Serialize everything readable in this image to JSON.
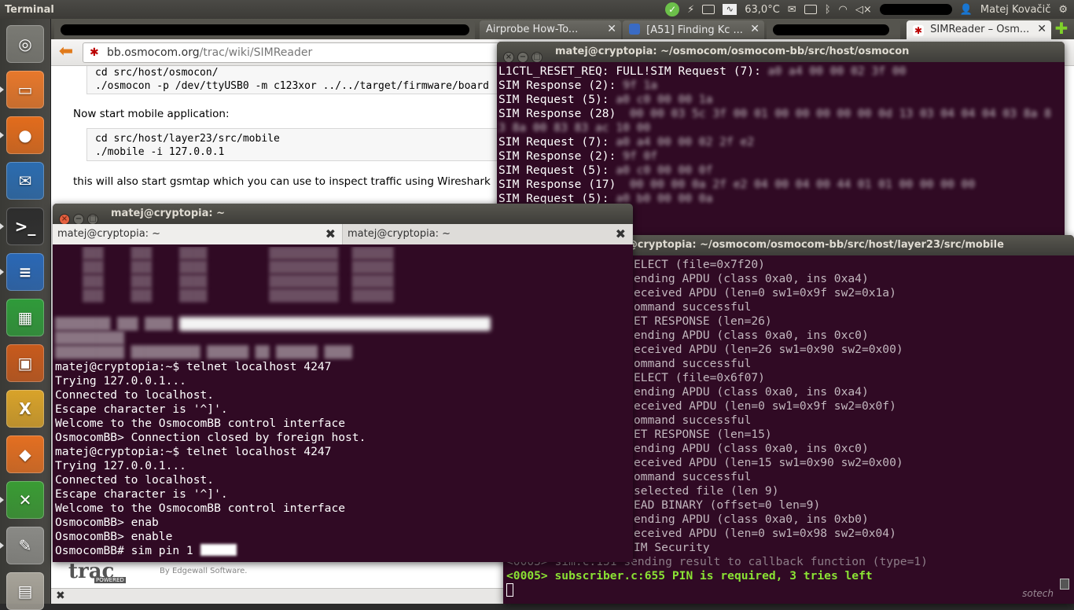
{
  "top_panel": {
    "app_title": "Terminal",
    "temperature": "63,0°C",
    "user_name": "Matej Kovačič"
  },
  "launcher": {
    "items": [
      {
        "name": "dash-home",
        "glyph": "◎",
        "color": "#7a7a74"
      },
      {
        "name": "files",
        "glyph": "▭",
        "color": "#e8782b"
      },
      {
        "name": "firefox",
        "glyph": "●",
        "color": "#e36c1c"
      },
      {
        "name": "thunderbird",
        "glyph": "✉",
        "color": "#2b6cb0"
      },
      {
        "name": "terminal",
        "glyph": ">_",
        "color": "#2d2d2d"
      },
      {
        "name": "writer",
        "glyph": "≡",
        "color": "#2a68b6"
      },
      {
        "name": "calc",
        "glyph": "▦",
        "color": "#2f9b3a"
      },
      {
        "name": "impress",
        "glyph": "▣",
        "color": "#c85a1c"
      },
      {
        "name": "xchat",
        "glyph": "X",
        "color": "#d9a32a"
      },
      {
        "name": "software-center",
        "glyph": "◆",
        "color": "#e46f21"
      },
      {
        "name": "x-app",
        "glyph": "✕",
        "color": "#3a9c34"
      },
      {
        "name": "text-editor",
        "glyph": "✎",
        "color": "#8a8a86"
      },
      {
        "name": "printer",
        "glyph": "▤",
        "color": "#a8a49a"
      }
    ]
  },
  "browser": {
    "tabs": [
      {
        "label": "Airprobe How-To..."
      },
      {
        "label": "[A51] Finding Kc ..."
      },
      {
        "label": "SIMReader – Osm..."
      }
    ],
    "url_domain": "bb.osmocom.org",
    "url_path": "/trac/wiki/SIMReader",
    "code1_lines": [
      "cd src/host/osmocon/",
      "./osmocon -p /dev/ttyUSB0 -m c123xor ../../target/firmware/board"
    ],
    "text1": "Now start mobile application:",
    "code2_lines": [
      "cd src/host/layer23/src/mobile",
      "./mobile -i 127.0.0.1"
    ],
    "text2": "this will also start gsmtap which you can use to inspect traffic using Wireshark",
    "trac_logo": "trac",
    "trac_powered": "POWERED",
    "edgewall": "By Edgewall Software."
  },
  "osmocon_terminal": {
    "title": "matej@cryptopia: ~/osmocom/osmocom-bb/src/host/osmocon",
    "lines": [
      "L1CTL_RESET_REQ: FULL!SIM Request (7): ",
      "SIM Response (2): ",
      "SIM Request (5): ",
      "SIM Response (28) ",
      "",
      "SIM Request (7): ",
      "SIM Response (2): ",
      "SIM Request (5): ",
      "SIM Response (17) ",
      "SIM Request (5): "
    ],
    "blurred_hex": [
      "a0 a4 00 00 02 3f 00",
      "9f 1a",
      "a0 c0 00 00 1a",
      " 00 00 03 5c 3f 00 01 00 00 00 00 00 0d 13 03 04 04 04 03 8a 8",
      "3 8a 00 83 83 ac 10 00",
      "a0 a4 00 00 02 2f e2",
      "9f 0f",
      "a0 c0 00 00 0f",
      " 00 00 00 0a 2f e2 04 00 04 00 44 01 01 00 00 00 00",
      "a0 b0 00 00 0a"
    ]
  },
  "mobile_terminal": {
    "title": "matej@cryptopia: ~/osmocom/osmocom-bb/src/host/layer23/src/mobile",
    "lines": [
      "ELECT (file=0x7f20)",
      "ending APDU (class 0xa0, ins 0xa4)",
      "eceived APDU (len=0 sw1=0x9f sw2=0x1a)",
      "ommand successful",
      "ET RESPONSE (len=26)",
      "ending APDU (class 0xa0, ins 0xc0)",
      "eceived APDU (len=26 sw1=0x90 sw2=0x00)",
      "ommand successful",
      "ELECT (file=0x6f07)",
      "ending APDU (class 0xa0, ins 0xa4)",
      "eceived APDU (len=0 sw1=0x9f sw2=0x0f)",
      "ommand successful",
      "ET RESPONSE (len=15)",
      "ending APDU (class 0xa0, ins 0xc0)",
      "eceived APDU (len=15 sw1=0x90 sw2=0x00)",
      "ommand successful",
      "selected file (len 9)",
      "EAD BINARY (offset=0 len=9)",
      "ending APDU (class 0xa0, ins 0xb0)",
      "eceived APDU (len=0 sw1=0x98 sw2=0x04)",
      "IM Security",
      "<0005> sim.c:151 sending result to callback function (type=1)"
    ],
    "highlight_line": "<0005> subscriber.c:655 PIN is required, 3 tries left",
    "watermark": "sotech"
  },
  "telnet_terminal": {
    "title": "matej@cryptopia: ~",
    "tabs": [
      {
        "label": "matej@cryptopia: ~"
      },
      {
        "label": "matej@cryptopia: ~"
      }
    ],
    "lines": [
      "matej@cryptopia:~$ telnet localhost 4247",
      "Trying 127.0.0.1...",
      "Connected to localhost.",
      "Escape character is '^]'.",
      "Welcome to the OsmocomBB control interface",
      "OsmocomBB> Connection closed by foreign host.",
      "matej@cryptopia:~$ telnet localhost 4247",
      "Trying 127.0.0.1...",
      "Connected to localhost.",
      "Escape character is '^]'.",
      "Welcome to the OsmocomBB control interface",
      "OsmocomBB> enab",
      "OsmocomBB> enable",
      "OsmocomBB# sim pin 1 "
    ]
  },
  "colors": {
    "terminal_bg": "#300a24",
    "highlight_green": "#8ae234"
  }
}
